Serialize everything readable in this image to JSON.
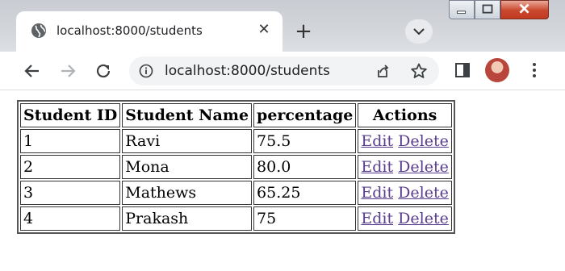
{
  "browser": {
    "tab": {
      "title": "localhost:8000/students",
      "close_glyph": "✕",
      "icon": "globe-icon"
    },
    "new_tab_glyph": "+",
    "tab_search_glyph": "⌄",
    "address_bar": {
      "url": "localhost:8000/students"
    },
    "accent_color": "#5a3d8c"
  },
  "table": {
    "headers": [
      "Student ID",
      "Student Name",
      "percentage",
      "Actions"
    ],
    "rows": [
      {
        "id": "1",
        "name": "Ravi",
        "percentage": "75.5",
        "edit": "Edit",
        "delete": "Delete"
      },
      {
        "id": "2",
        "name": "Mona",
        "percentage": "80.0",
        "edit": "Edit",
        "delete": "Delete"
      },
      {
        "id": "3",
        "name": "Mathews",
        "percentage": "65.25",
        "edit": "Edit",
        "delete": "Delete"
      },
      {
        "id": "4",
        "name": "Prakash",
        "percentage": "75",
        "edit": "Edit",
        "delete": "Delete"
      }
    ]
  }
}
